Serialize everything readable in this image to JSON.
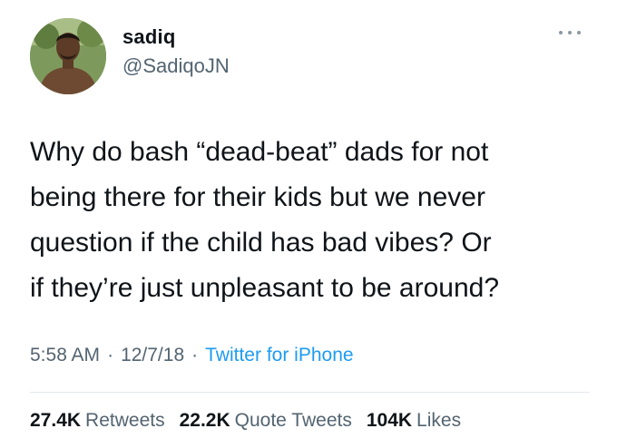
{
  "user": {
    "display_name": "sadiq",
    "handle": "@SadiqoJN"
  },
  "tweet": {
    "text": "Why do bash “dead-beat” dads for not\nbeing there for their kids but we never\nquestion if the child has bad vibes? Or\nif they’re just unpleasant to be around?",
    "time": "5:58 AM",
    "date": "12/7/18",
    "separator": "·",
    "source": "Twitter for iPhone"
  },
  "stats": {
    "retweets_count": "27.4K",
    "retweets_label": "Retweets",
    "quotes_count": "22.2K",
    "quotes_label": "Quote Tweets",
    "likes_count": "104K",
    "likes_label": "Likes"
  },
  "icons": {
    "more": "more-options-icon"
  },
  "colors": {
    "text": "#0f1419",
    "secondary": "#536471",
    "link": "#1d9bf0"
  }
}
